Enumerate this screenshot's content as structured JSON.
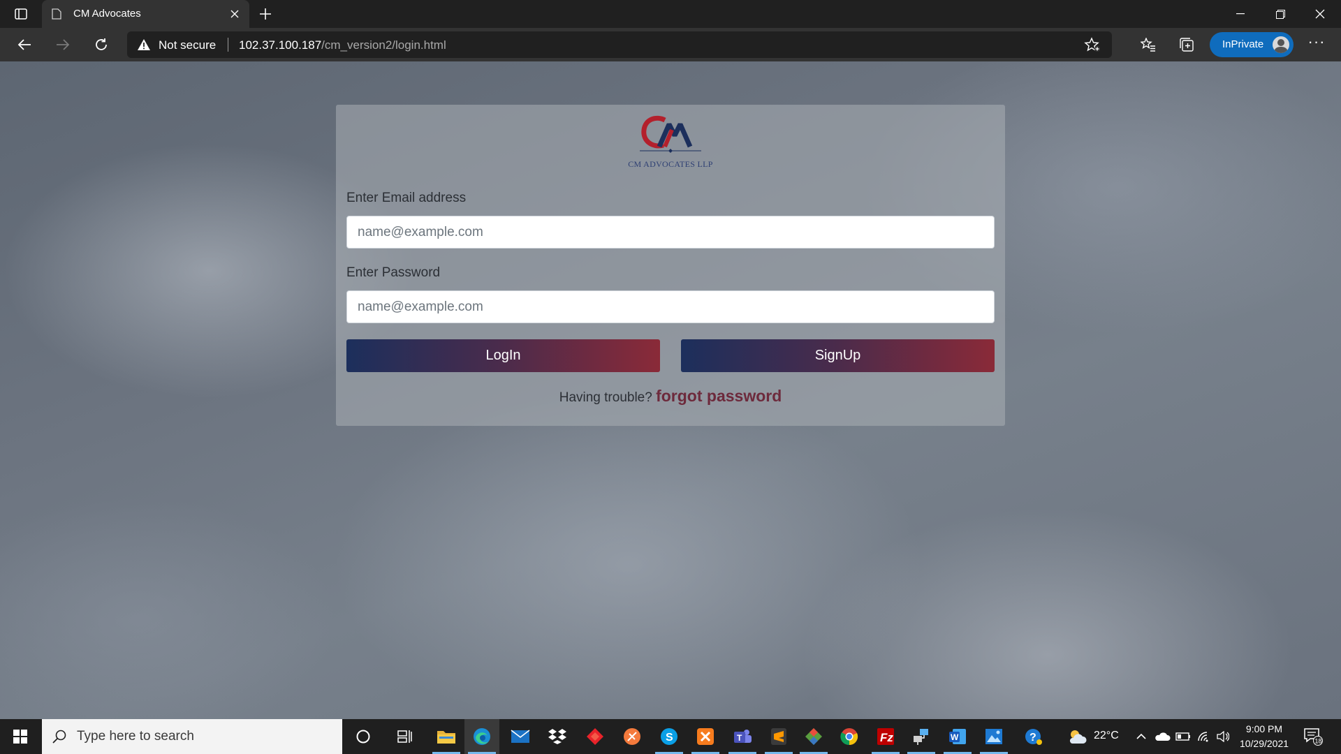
{
  "browser": {
    "tab_title": "CM Advocates",
    "security_label": "Not secure",
    "url_host": "102.37.100.187",
    "url_path": "/cm_version2/login.html",
    "inprivate_label": "InPrivate"
  },
  "page": {
    "logo_text": "CM ADVOCATES LLP",
    "email_label": "Enter Email address",
    "email_placeholder": "name@example.com",
    "password_label": "Enter Password",
    "password_placeholder": "name@example.com",
    "login_button": "LogIn",
    "signup_button": "SignUp",
    "trouble_text": "Having trouble?",
    "forgot_link": "forgot password"
  },
  "taskbar": {
    "search_placeholder": "Type here to search",
    "weather_temp": "22°C",
    "time": "9:00 PM",
    "date": "10/29/2021",
    "notification_count": "18",
    "apps": [
      "cortana-icon",
      "task-view-icon",
      "file-explorer-icon",
      "edge-icon",
      "mail-icon",
      "dropbox-icon",
      "git-kraken-icon",
      "swift-icon",
      "skype-icon",
      "xampp-icon",
      "teams-icon",
      "sublime-icon",
      "git-icon",
      "chrome-icon",
      "filezilla-icon",
      "network-icon",
      "word-icon",
      "photos-icon",
      "help-icon"
    ]
  },
  "colors": {
    "primary_gradient_start": "#1c2f5c",
    "primary_gradient_end": "#8a2a38",
    "link_color": "#6d2a3c",
    "inprivate_blue": "#0f6cbd"
  }
}
